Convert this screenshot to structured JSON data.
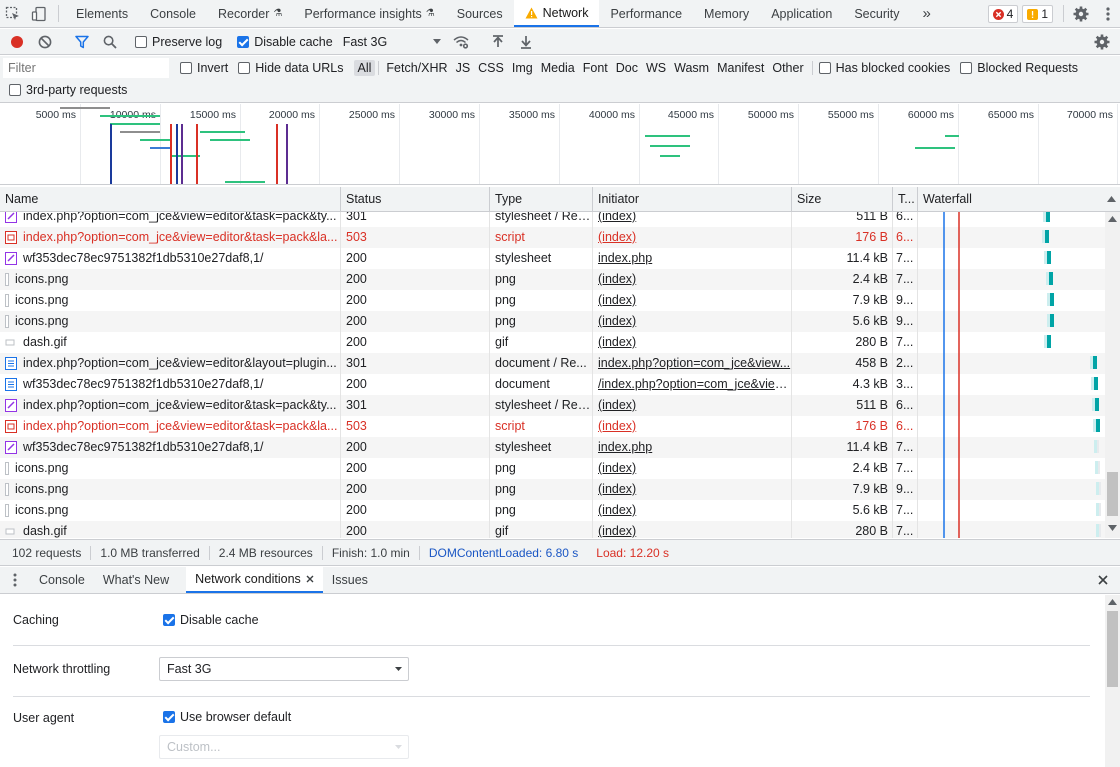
{
  "tabbar": {
    "tabs": [
      "Elements",
      "Console",
      "Recorder",
      "Performance insights",
      "Sources",
      "Network",
      "Performance",
      "Memory",
      "Application",
      "Security"
    ],
    "more": "»",
    "errors": "4",
    "warnings": "1"
  },
  "toolbar": {
    "preserve_log": "Preserve log",
    "disable_cache": "Disable cache",
    "throttle": "Fast 3G"
  },
  "filter": {
    "placeholder": "Filter",
    "invert": "Invert",
    "hide_data": "Hide data URLs",
    "types": [
      "All",
      "Fetch/XHR",
      "JS",
      "CSS",
      "Img",
      "Media",
      "Font",
      "Doc",
      "WS",
      "Wasm",
      "Manifest",
      "Other"
    ],
    "blocked_cookies": "Has blocked cookies",
    "blocked_requests": "Blocked Requests",
    "third_party": "3rd-party requests"
  },
  "overview": {
    "ticks": [
      "5000 ms",
      "10000 ms",
      "15000 ms",
      "20000 ms",
      "25000 ms",
      "30000 ms",
      "35000 ms",
      "40000 ms",
      "45000 ms",
      "50000 ms",
      "55000 ms",
      "60000 ms",
      "65000 ms",
      "70000 ms"
    ]
  },
  "columns": [
    "Name",
    "Status",
    "Type",
    "Initiator",
    "Size",
    "T...",
    "Waterfall"
  ],
  "rows": [
    {
      "name": "index.php?option=com_jce&view=editor&task=pack&ty...",
      "status": "301",
      "type": "stylesheet / Red...",
      "initiator": "(index)",
      "size": "511 B",
      "time": "6...",
      "kind": "css",
      "err": false
    },
    {
      "name": "index.php?option=com_jce&view=editor&task=pack&la...",
      "status": "503",
      "type": "script",
      "initiator": "(index)",
      "size": "176 B",
      "time": "6...",
      "kind": "js",
      "err": true
    },
    {
      "name": "wf353dec78ec9751382f1db5310e27daf8,1/",
      "status": "200",
      "type": "stylesheet",
      "initiator": "index.php",
      "size": "11.4 kB",
      "time": "7...",
      "kind": "css",
      "err": false
    },
    {
      "name": "icons.png",
      "status": "200",
      "type": "png",
      "initiator": "(index)",
      "size": "2.4 kB",
      "time": "7...",
      "kind": "img",
      "err": false
    },
    {
      "name": "icons.png",
      "status": "200",
      "type": "png",
      "initiator": "(index)",
      "size": "7.9 kB",
      "time": "9...",
      "kind": "img",
      "err": false
    },
    {
      "name": "icons.png",
      "status": "200",
      "type": "png",
      "initiator": "(index)",
      "size": "5.6 kB",
      "time": "9...",
      "kind": "img",
      "err": false
    },
    {
      "name": "dash.gif",
      "status": "200",
      "type": "gif",
      "initiator": "(index)",
      "size": "280 B",
      "time": "7...",
      "kind": "gif",
      "err": false
    },
    {
      "name": "index.php?option=com_jce&view=editor&layout=plugin...",
      "status": "301",
      "type": "document / Re...",
      "initiator": "index.php?option=com_jce&view...",
      "size": "458 B",
      "time": "2...",
      "kind": "doc",
      "err": false
    },
    {
      "name": "wf353dec78ec9751382f1db5310e27daf8,1/",
      "status": "200",
      "type": "document",
      "initiator": "/index.php?option=com_jce&view...",
      "size": "4.3 kB",
      "time": "3...",
      "kind": "doc",
      "err": false
    },
    {
      "name": "index.php?option=com_jce&view=editor&task=pack&ty...",
      "status": "301",
      "type": "stylesheet / Red...",
      "initiator": "(index)",
      "size": "511 B",
      "time": "6...",
      "kind": "css",
      "err": false
    },
    {
      "name": "index.php?option=com_jce&view=editor&task=pack&la...",
      "status": "503",
      "type": "script",
      "initiator": "(index)",
      "size": "176 B",
      "time": "6...",
      "kind": "js",
      "err": true
    },
    {
      "name": "wf353dec78ec9751382f1db5310e27daf8,1/",
      "status": "200",
      "type": "stylesheet",
      "initiator": "index.php",
      "size": "11.4 kB",
      "time": "7...",
      "kind": "css",
      "err": false
    },
    {
      "name": "icons.png",
      "status": "200",
      "type": "png",
      "initiator": "(index)",
      "size": "2.4 kB",
      "time": "7...",
      "kind": "img",
      "err": false
    },
    {
      "name": "icons.png",
      "status": "200",
      "type": "png",
      "initiator": "(index)",
      "size": "7.9 kB",
      "time": "9...",
      "kind": "img",
      "err": false
    },
    {
      "name": "icons.png",
      "status": "200",
      "type": "png",
      "initiator": "(index)",
      "size": "5.6 kB",
      "time": "7...",
      "kind": "img",
      "err": false
    },
    {
      "name": "dash.gif",
      "status": "200",
      "type": "gif",
      "initiator": "(index)",
      "size": "280 B",
      "time": "7...",
      "kind": "gif",
      "err": false
    }
  ],
  "status": {
    "requests": "102 requests",
    "transferred": "1.0 MB transferred",
    "resources": "2.4 MB resources",
    "finish": "Finish: 1.0 min",
    "dcl": "DOMContentLoaded: 6.80 s",
    "load": "Load: 12.20 s"
  },
  "drawer": {
    "tabs": [
      "Console",
      "What's New",
      "Network conditions",
      "Issues"
    ]
  },
  "conditions": {
    "caching_label": "Caching",
    "caching_check": "Disable cache",
    "throttle_label": "Network throttling",
    "throttle_value": "Fast 3G",
    "ua_label": "User agent",
    "ua_check": "Use browser default",
    "ua_placeholder": "Custom..."
  },
  "colors": {
    "accent": "#1a73e8",
    "error": "#d93025",
    "dcl": "#1a73e8",
    "load": "#d93025"
  }
}
